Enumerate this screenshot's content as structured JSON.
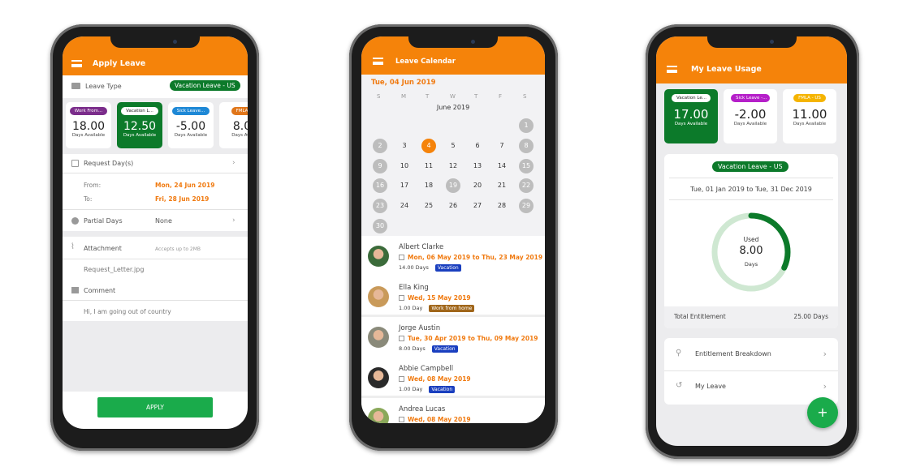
{
  "apply": {
    "title": "Apply Leave",
    "leave_type_label": "Leave Type",
    "leave_type_value": "Vacation Leave - US",
    "cards": [
      {
        "chip": "Work From...",
        "value": "18.00",
        "sub": "Days Available",
        "color": "#7b2d8b",
        "selected": false
      },
      {
        "chip": "Vacation L...",
        "value": "12.50",
        "sub": "Days Available",
        "color": "#0c7a2a",
        "selected": true
      },
      {
        "chip": "Sick Leave...",
        "value": "-5.00",
        "sub": "Days Available",
        "color": "#1e88d6",
        "selected": false
      },
      {
        "chip": "FMLA",
        "value": "8.0",
        "sub": "Days Ava",
        "color": "#e0761a",
        "selected": false
      }
    ],
    "request_label": "Request Day(s)",
    "from_label": "From:",
    "from_value": "Mon, 24 Jun 2019",
    "to_label": "To:",
    "to_value": "Fri, 28 Jun 2019",
    "partial_label": "Partial Days",
    "partial_value": "None",
    "attachment_label": "Attachment",
    "attachment_hint": "Accepts up to 2MB",
    "attachment_file": "Request_Letter.jpg",
    "comment_label": "Comment",
    "comment_value": "Hi, I am going out of country",
    "apply_button": "APPLY"
  },
  "calendar": {
    "title": "Leave Calendar",
    "selected_date": "Tue, 04 Jun 2019",
    "weekdays": [
      "S",
      "M",
      "T",
      "W",
      "T",
      "F",
      "S"
    ],
    "month": "June 2019",
    "first_weekday": 6,
    "days_in_month": 30,
    "selected_day": 4,
    "highlighted_days": [
      1,
      2,
      8,
      9,
      15,
      16,
      19,
      22,
      23,
      29,
      30
    ],
    "entries": [
      {
        "name": "Albert Clarke",
        "dates": "Mon, 06 May 2019 to Thu, 23 May 2019",
        "duration": "14.00 Days",
        "tag": "Vacation",
        "tag_color": "#1a3fbf"
      },
      {
        "name": "Ella King",
        "dates": "Wed, 15 May 2019",
        "duration": "1.00 Day",
        "tag": "Work from home",
        "tag_color": "#a0661a"
      },
      {
        "name": "Jorge Austin",
        "dates": "Tue, 30 Apr 2019 to Thu, 09 May 2019",
        "duration": "8.00 Days",
        "tag": "Vacation",
        "tag_color": "#1a3fbf"
      },
      {
        "name": "Abbie Campbell",
        "dates": "Wed, 08 May 2019",
        "duration": "1.00 Day",
        "tag": "Vacation",
        "tag_color": "#1a3fbf"
      },
      {
        "name": "Andrea Lucas",
        "dates": "Wed, 08 May 2019",
        "duration": "",
        "tag": "",
        "tag_color": ""
      }
    ]
  },
  "usage": {
    "title": "My Leave Usage",
    "cards": [
      {
        "chip": "Vacation Le...",
        "value": "17.00",
        "sub": "Days Available",
        "color": "#0c7a2a",
        "selected": true
      },
      {
        "chip": "Sick Leave -...",
        "value": "-2.00",
        "sub": "Days Available",
        "color": "#b51fc9",
        "selected": false
      },
      {
        "chip": "FMLA - US",
        "value": "11.00",
        "sub": "Days Available",
        "color": "#f5b400",
        "selected": false
      }
    ],
    "leave_type": "Vacation Leave - US",
    "period": "Tue, 01 Jan 2019 to Tue, 31 Dec 2019",
    "used_label": "Used",
    "used_value": "8.00",
    "used_unit": "Days",
    "used_fraction": 0.32,
    "total_label": "Total Entitlement",
    "total_value": "25.00 Days",
    "menu": [
      {
        "label": "Entitlement Breakdown",
        "icon": "hierarchy-icon"
      },
      {
        "label": "My Leave",
        "icon": "history-icon"
      }
    ],
    "fab": "+"
  },
  "colors": {
    "accent": "#f5830a",
    "green": "#0c7a2a",
    "apply": "#1aab4b"
  }
}
